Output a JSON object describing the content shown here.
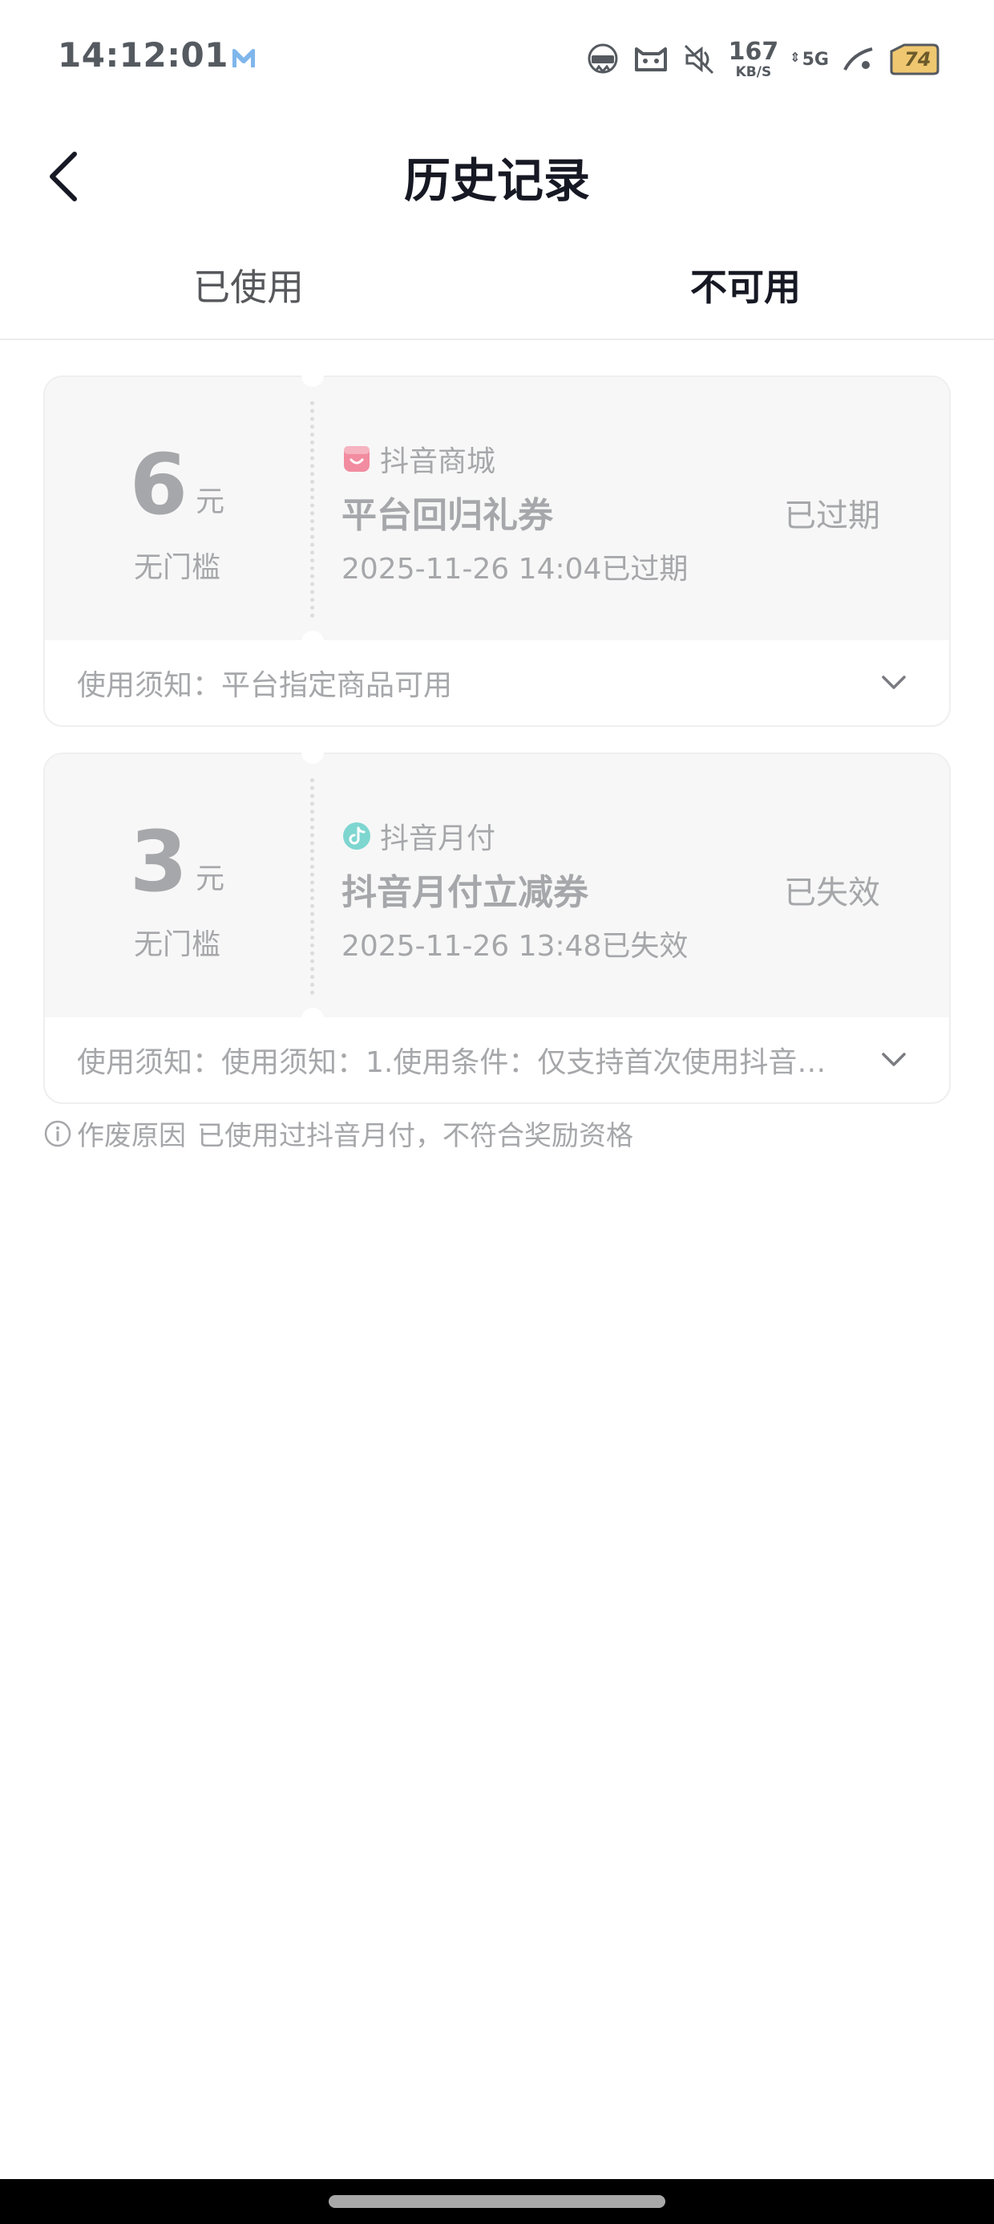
{
  "status_bar": {
    "time": "14:12:01",
    "network_speed_value": "167",
    "network_speed_unit": "KB/S",
    "network_type": "5G",
    "battery_level": "74",
    "icons": [
      "app-m-icon",
      "nfc-icon",
      "cat-face-icon",
      "mute-icon",
      "signal-icon",
      "battery-icon"
    ]
  },
  "header": {
    "title": "历史记录",
    "back_icon": "chevron-left-icon"
  },
  "tabs": [
    {
      "label": "已使用",
      "active": false
    },
    {
      "label": "不可用",
      "active": true
    }
  ],
  "coupons": [
    {
      "amount": "6",
      "unit": "元",
      "threshold": "无门槛",
      "source": "抖音商城",
      "source_icon": "mall-shop-icon",
      "name": "平台回归礼券",
      "time": "2025-11-26 14:04已过期",
      "status": "已过期",
      "notice": "使用须知：平台指定商品可用"
    },
    {
      "amount": "3",
      "unit": "元",
      "threshold": "无门槛",
      "source": "抖音月付",
      "source_icon": "douyin-pay-icon",
      "name": "抖音月付立减券",
      "time": "2025-11-26 13:48已失效",
      "status": "已失效",
      "notice": "使用须知：使用须知：1.使用条件：仅支持首次使用抖音月..."
    }
  ],
  "void_reason": {
    "label": "作废原因",
    "text": "已使用过抖音月付，不符合奖励资格"
  },
  "colors": {
    "primary_text": "#161823",
    "muted_text": "#a6a7aa",
    "card_bg": "#f7f7f7",
    "mall_icon": "#f28ca0",
    "pay_icon": "#7ed6d0"
  }
}
